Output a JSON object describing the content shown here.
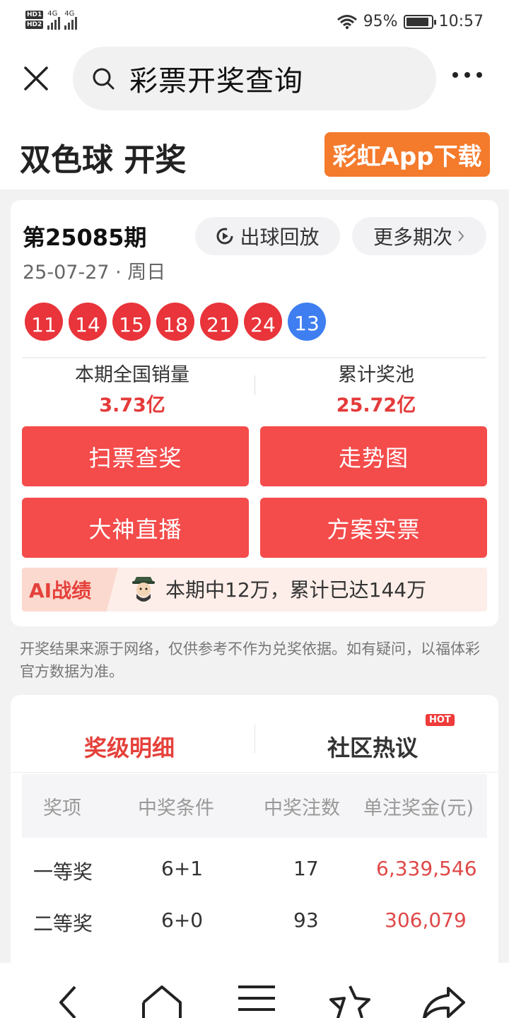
{
  "status": {
    "sim1": "HD1",
    "sim2": "HD2",
    "net1": "4G",
    "net2": "4G",
    "battery": "95%",
    "time": "10:57"
  },
  "search": {
    "query": "彩票开奖查询"
  },
  "header": {
    "title": "双色球 开奖",
    "app_button": "彩虹App下载"
  },
  "draw": {
    "issue": "第25085期",
    "date": "25-07-27 · 周日",
    "replay_label": "出球回放",
    "more_label": "更多期次",
    "red_balls": [
      "11",
      "14",
      "15",
      "18",
      "21",
      "24"
    ],
    "blue_ball": "13",
    "sales_label": "本期全国销量",
    "sales_value": "3.73亿",
    "pool_label": "累计奖池",
    "pool_value": "25.72亿",
    "buttons": [
      "扫票查奖",
      "走势图",
      "大神直播",
      "方案实票"
    ],
    "ai_tag": "AI战绩",
    "ai_text": "本期中12万，累计已达144万"
  },
  "disclaimer": "开奖结果来源于网络，仅供参考不作为兑奖依据。如有疑问，以福体彩官方数据为准。",
  "prize": {
    "tab_active": "奖级明细",
    "tab_other": "社区热议",
    "hot_badge": "HOT",
    "columns": [
      "奖项",
      "中奖条件",
      "中奖注数",
      "单注奖金(元)"
    ],
    "rows": [
      {
        "level": "一等奖",
        "cond": "6+1",
        "count": "17",
        "money": "6,339,546"
      },
      {
        "level": "二等奖",
        "cond": "6+0",
        "count": "93",
        "money": "306,079"
      }
    ]
  },
  "colors": {
    "red": "#f44b4b",
    "blue_ball": "#3e7ef0",
    "orange": "#f47a2c"
  }
}
